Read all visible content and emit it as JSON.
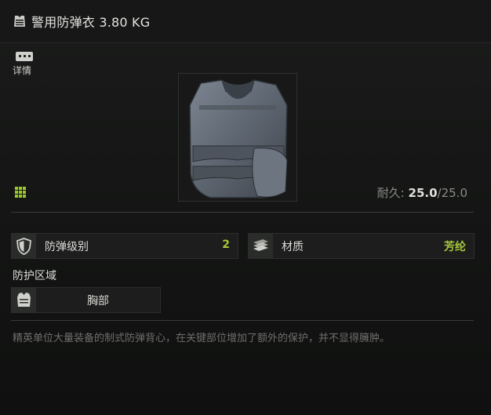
{
  "header": {
    "item_name": "警用防弹衣",
    "weight": "3.80 KG",
    "icon": "armor-vest-icon"
  },
  "actions": {
    "details_label": "详情",
    "details_icon": "ellipsis-icon",
    "grid_icon": "grid-icon"
  },
  "item": {
    "image": "body-armor-vest-image",
    "durability_label": "耐久:",
    "durability_current": "25.0",
    "durability_separator": "/",
    "durability_max": "25.0"
  },
  "stats": {
    "armor_class": {
      "label": "防弹级别",
      "value": "2",
      "icon": "shield-icon"
    },
    "material": {
      "label": "材质",
      "value": "芳纶",
      "icon": "material-stack-icon"
    }
  },
  "protection": {
    "title": "防护区域",
    "zones": [
      {
        "label": "胸部",
        "icon": "thorax-icon"
      }
    ]
  },
  "description": "精英单位大量装备的制式防弹背心，在关键部位增加了额外的保护，并不显得臃肿。",
  "colors": {
    "accent_value": "#a8c83a",
    "background": "#131413"
  }
}
